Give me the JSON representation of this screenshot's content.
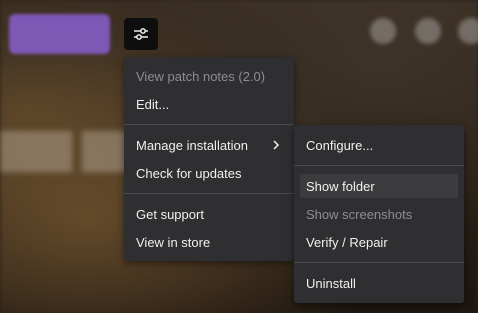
{
  "main_menu": {
    "items": [
      {
        "label": "View patch notes (2.0)",
        "disabled": true
      },
      {
        "label": "Edit..."
      },
      {
        "label": "Manage installation",
        "submenu": true
      },
      {
        "label": "Check for updates"
      },
      {
        "label": "Get support"
      },
      {
        "label": "View in store"
      }
    ]
  },
  "sub_menu": {
    "items": [
      {
        "label": "Configure..."
      },
      {
        "label": "Show folder",
        "hovered": true
      },
      {
        "label": "Show screenshots",
        "disabled": true
      },
      {
        "label": "Verify / Repair"
      },
      {
        "label": "Uninstall"
      }
    ]
  },
  "icons": {
    "settings": "sliders-icon",
    "submenu_arrow": "chevron-right-icon"
  },
  "colors": {
    "menu_bg": "#2f2f31",
    "disabled_text": "#8e8e90",
    "hover_bg": "#3c3c3e",
    "accent_button": "#8a5fd0"
  }
}
